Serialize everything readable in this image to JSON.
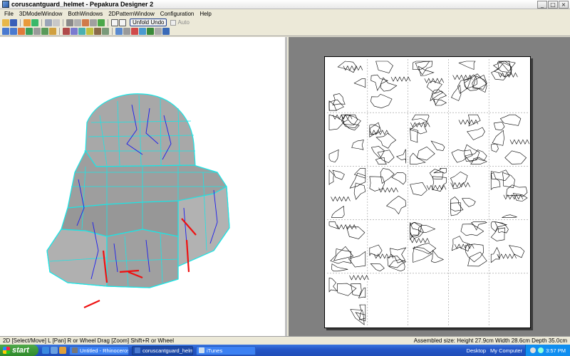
{
  "window": {
    "title": "coruscantguard_helmet - Pepakura Designer 2",
    "controls": [
      "_",
      "□",
      "×"
    ]
  },
  "menu": [
    "File",
    "3DModelWindow",
    "BothWindows",
    "2DPatternWindow",
    "Configuration",
    "Help"
  ],
  "toolbar": {
    "unfold_undo_label": "Unfold Undo",
    "auto_label": "Auto"
  },
  "status": {
    "left": "2D [Select/Move] L [Pan] R or Wheel Drag [Zoom] Shift+R or Wheel",
    "right": "Assembled size: Height 27.9cm Width 28.6cm Depth 35.0cm"
  },
  "taskbar": {
    "start_label": "start",
    "tasks": [
      {
        "label": "Untitled - Rhinoceros",
        "active": false
      },
      {
        "label": "coruscantguard_helm...",
        "active": true
      },
      {
        "label": "iTunes",
        "active": false
      }
    ],
    "tray_links": [
      "Desktop",
      "My Computer"
    ],
    "clock": "3:57 PM"
  },
  "colors": {
    "edge_cyan": "#19e6e6",
    "edge_blue": "#1a1aee",
    "edge_red": "#ee1111",
    "mesh_gray": "#9e9e9e",
    "paper_bg": "#808080",
    "taskbar_blue": "#2456c7"
  },
  "pattern": {
    "columns": 5,
    "rows": 5
  }
}
